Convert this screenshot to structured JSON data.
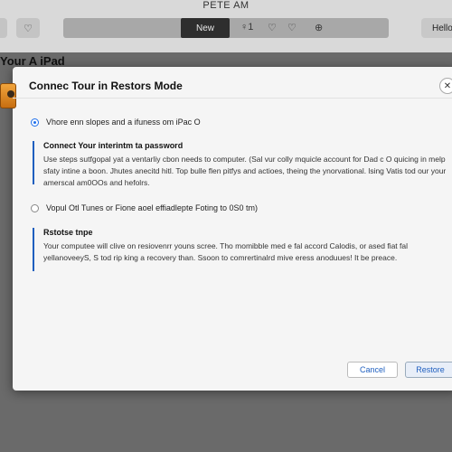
{
  "status_bar": {
    "time": "PETE AM"
  },
  "toolbar": {
    "new_label": "New",
    "icon_a": "♀1",
    "icon_b": "♡",
    "icon_c": "♡",
    "icon_d": "⊕",
    "help_label": "Hello"
  },
  "page": {
    "title": "Your A iPad"
  },
  "dialog": {
    "title": "Connec Tour in Restors Mode",
    "close_glyph": "✕",
    "option_one": {
      "label": "Vhore enn slopes and a ifuness om iPac O",
      "selected": true
    },
    "section_one": {
      "title": "Connect Your interintm ta password",
      "body": "Use steps sutfgopal yat a ventarliy cbon needs to computer. (Sal vur colly mquicle account for Dad c O quicing in melp sfaty intine a boon. Jhutes anecitd hitl. Top bulle flen pitfys and actioes, theing the ynorvational. lsing Vatis tod our your amerscal am0OOs and hefolrs."
    },
    "option_two": {
      "label": "Vopul Otl Tunes or Fione aoel effiadlepte Foting to 0S0 tm)",
      "selected": false
    },
    "section_two": {
      "title": "Rstotse tnpe",
      "body": "Your computee will clive on resiovenrr youns scree. Tho momibble med e fal accord Calodis, or ased fiat fal yellanoveeyS, S tod rip king a recovery than. Ssoon to comrertinalrd mive eress anoduues! It be preace."
    },
    "cancel_label": "Cancel",
    "restore_label": "Restore"
  },
  "colors": {
    "accent": "#1f5fbf",
    "toolbar_dark": "#2e2e2e",
    "icon_orange": "#e08a22"
  }
}
